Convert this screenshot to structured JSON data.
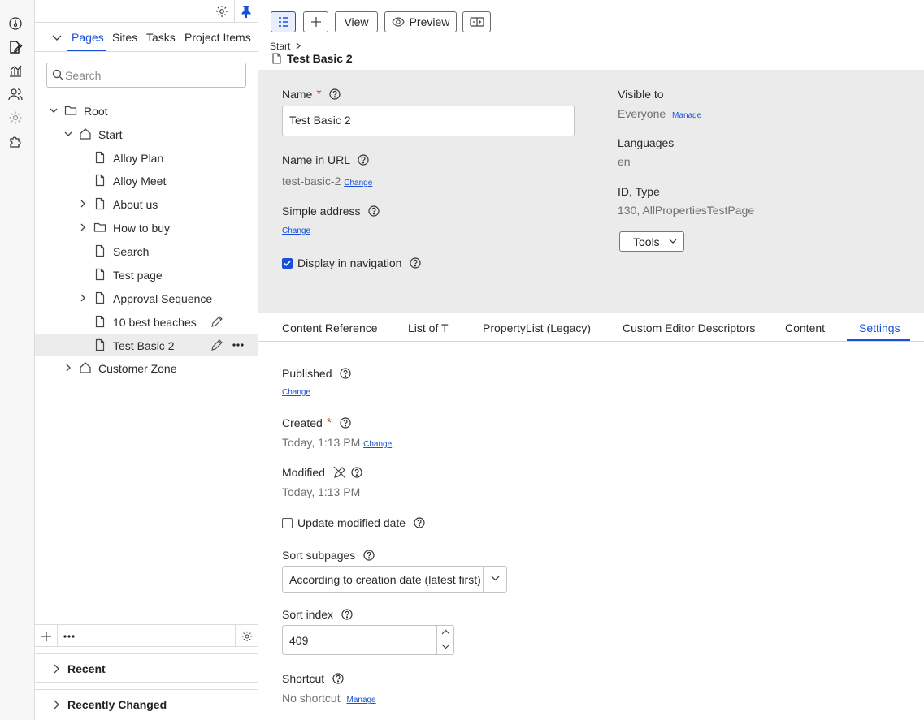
{
  "nav": {
    "tabs": [
      "Pages",
      "Sites",
      "Tasks",
      "Project Items"
    ],
    "search_placeholder": "Search",
    "tree": [
      {
        "label": "Root",
        "icon": "folder-icon",
        "expanded": true
      },
      {
        "label": "Start",
        "icon": "home-icon",
        "expanded": true
      },
      {
        "label": "Alloy Plan",
        "icon": "page-icon"
      },
      {
        "label": "Alloy Meet",
        "icon": "page-icon"
      },
      {
        "label": "About us",
        "icon": "page-icon",
        "expandable": true
      },
      {
        "label": "How to buy",
        "icon": "folder-icon",
        "expandable": true
      },
      {
        "label": "Search",
        "icon": "page-icon"
      },
      {
        "label": "Test page",
        "icon": "page-icon"
      },
      {
        "label": "Approval Sequence",
        "icon": "page-icon",
        "expandable": true
      },
      {
        "label": "10 best beaches",
        "icon": "page-icon"
      },
      {
        "label": "Test Basic 2",
        "icon": "page-icon",
        "selected": true
      },
      {
        "label": "Customer Zone",
        "icon": "home-icon",
        "expandable": true
      }
    ],
    "recent_label": "Recent",
    "recently_changed_label": "Recently Changed"
  },
  "toolbar": {
    "view_label": "View",
    "preview_label": "Preview"
  },
  "breadcrumb": {
    "start": "Start"
  },
  "page_title": "Test Basic 2",
  "props": {
    "name_label": "Name",
    "name_value": "Test Basic 2",
    "url_label": "Name in URL",
    "url_value": "test-basic-2",
    "change_label": "Change",
    "simple_address_label": "Simple address",
    "display_nav_label": "Display in navigation",
    "visible_label": "Visible to",
    "visible_value": "Everyone",
    "manage_label": "Manage",
    "languages_label": "Languages",
    "languages_value": "en",
    "idtype_label": "ID, Type",
    "idtype_value": "130, AllPropertiesTestPage",
    "tools_label": "Tools"
  },
  "content_tabs": [
    "Content Reference",
    "List of T",
    "PropertyList (Legacy)",
    "Custom Editor Descriptors",
    "Content",
    "Settings"
  ],
  "settings": {
    "published_label": "Published",
    "created_label": "Created",
    "created_value": "Today, 1:13 PM",
    "modified_label": "Modified",
    "modified_value": "Today, 1:13 PM",
    "update_modified_label": "Update modified date",
    "sort_subpages_label": "Sort subpages",
    "sort_subpages_value": "According to creation date (latest first)",
    "sort_index_label": "Sort index",
    "sort_index_value": "409",
    "shortcut_label": "Shortcut",
    "shortcut_value": "No shortcut"
  },
  "colors": {
    "accent": "#1850d8",
    "required": "#d43a22",
    "panel": "#ebebeb"
  }
}
